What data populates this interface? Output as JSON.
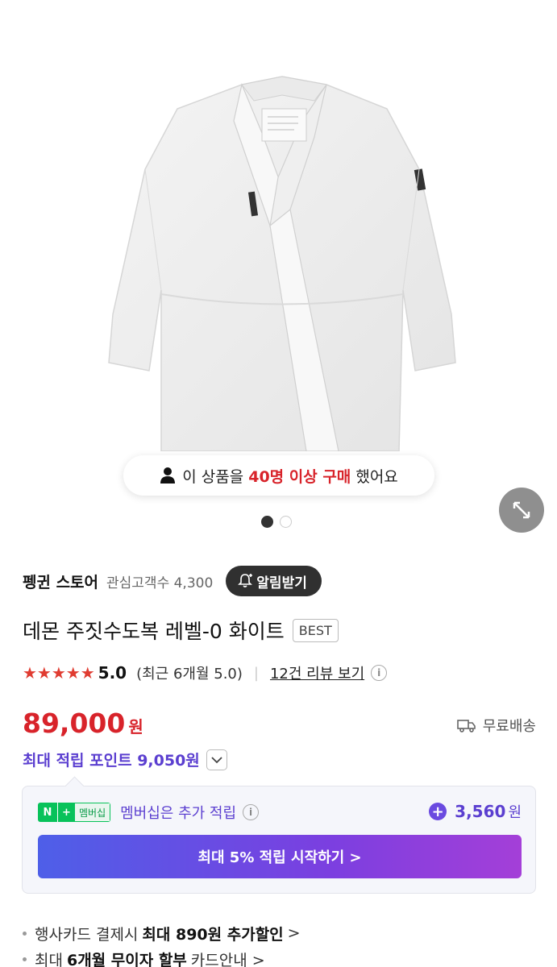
{
  "hero": {
    "buy_prefix": "이 상품을",
    "buy_highlight": "40명 이상 구매",
    "buy_suffix": "했어요",
    "dots_total": 2,
    "dots_active": 1
  },
  "store": {
    "name": "펭귄 스토어",
    "fans": "관심고객수 4,300",
    "alarm_label": "알림받기"
  },
  "product": {
    "title": "데몬 주짓수도복 레벨-0 화이트",
    "badge": "BEST"
  },
  "rating": {
    "stars": "★★★★★",
    "score": "5.0",
    "recent": "(최근 6개월 5.0)",
    "separator": "|",
    "review_link": "12건 리뷰 보기"
  },
  "price": {
    "amount": "89,000",
    "unit": "원",
    "shipping": "무료배송"
  },
  "points": {
    "label": "최대 적립 포인트 9,050원"
  },
  "membership": {
    "badge_n": "N",
    "badge_plus": "+",
    "badge_text": "멤버십",
    "text": "멤버십은 추가 적립",
    "amount": "3,560",
    "unit": "원",
    "cta": "최대 5% 적립 시작하기 >"
  },
  "bullets": [
    {
      "pre": "행사카드 결제시",
      "bold": "최대 890원 추가할인",
      "post": ">"
    },
    {
      "pre": "최대",
      "bold": "6개월 무이자 할부",
      "post": "카드안내 >"
    }
  ],
  "colors": {
    "price_red": "#d8232a",
    "point_purple": "#5b3fd0",
    "naver_green": "#08c25a"
  }
}
